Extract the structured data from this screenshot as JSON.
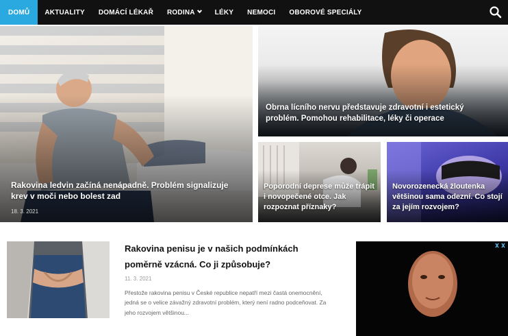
{
  "nav": {
    "items": [
      {
        "label": "DOMŮ",
        "active": true
      },
      {
        "label": "AKTUALITY"
      },
      {
        "label": "DOMÁCÍ LÉKAŘ"
      },
      {
        "label": "RODINA",
        "dropdown": true
      },
      {
        "label": "LÉKY"
      },
      {
        "label": "NEMOCI"
      },
      {
        "label": "OBOROVÉ SPECIÁLY"
      }
    ],
    "search_icon": "search-icon",
    "accent": "#2aa9e0"
  },
  "featured": {
    "main": {
      "title": "Rakovina ledvin začíná nenápadně. Problém signalizuje krev v moči nebo bolest zad",
      "date": "18. 3. 2021"
    },
    "top_right": {
      "title": "Obrna lícního nervu představuje zdravotní i estetický problém. Pomohou rehabilitace, léky či operace"
    },
    "bottom_left": {
      "title": "Poporodní deprese může trápit i novopečené otce. Jak rozpoznat příznaky?"
    },
    "bottom_right": {
      "title": "Novorozenecká žloutenka většinou sama odezní. Co stojí za jejím rozvojem?"
    }
  },
  "article": {
    "title": "Rakovina penisu je v našich podmínkách poměrně vzácná. Co ji způsobuje?",
    "date": "11. 3. 2021",
    "excerpt": "Přestože rakovina penisu v České republice nepatří mezi častá onemocnění, jedná se o velice závažný zdravotní problém, který není radno podceňovat. Za jeho rozvojem většinou..."
  }
}
